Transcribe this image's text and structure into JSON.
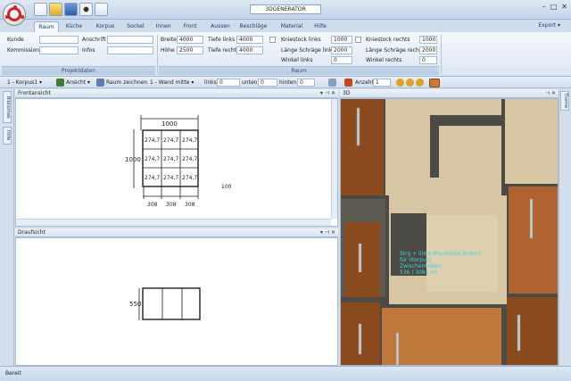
{
  "window": {
    "title": "3DGENERATOR",
    "controls": [
      "–",
      "□",
      "✕"
    ]
  },
  "tabs": [
    "Raum",
    "Küche",
    "Korpus",
    "Sockel",
    "Innen",
    "Front",
    "Aussen",
    "Beschläge",
    "Material",
    "Hilfe"
  ],
  "export_label": "Export ▾",
  "ribbon": {
    "projekt": {
      "footer": "Projektdaten",
      "kunde_label": "Kunde",
      "kommission_label": "Kommission",
      "anschrift_label": "Anschrift",
      "infos_label": "Infos"
    },
    "raum": {
      "footer": "Raum",
      "breite_label": "Breite",
      "breite_value": "4000",
      "hoehe_label": "Höhe",
      "hoehe_value": "2500",
      "tiefe_links_label": "Tiefe links",
      "tiefe_links_value": "4000",
      "tiefe_rechts_label": "Tiefe rechts",
      "tiefe_rechts_value": "4000",
      "kniestock_links_label": "Kniestock links",
      "kniestock_links_value": "1000",
      "laenge_links_label": "Länge Schräge links",
      "laenge_links_value": "2000",
      "winkel_links_label": "Winkel links",
      "winkel_links_value": "0",
      "kniestock_rechts_label": "Kniestock rechts",
      "kniestock_rechts_value": "1000",
      "laenge_rechts_label": "Länge Schräge rechts",
      "laenge_rechts_value": "2000",
      "winkel_rechts_label": "Winkel rechts",
      "winkel_rechts_value": "0"
    }
  },
  "toolbar": {
    "korpus": "1 - Korpus1 ▾",
    "ansicht": "Ansicht ▾",
    "raum_zeichnen": "Raum zeichnen",
    "wand": "1 - Wand mitte ▾",
    "links_label": "links",
    "links_value": "0",
    "unten_label": "unten",
    "unten_value": "0",
    "hinten_label": "hinten",
    "hinten_value": "0",
    "anzahl_label": "Anzahl",
    "anzahl_value": "1"
  },
  "side_tabs": [
    "Bibliothek",
    "Hilfe"
  ],
  "right_tab": "Theme",
  "panels": {
    "front_title": "Frontansicht",
    "top_title": "Draufsicht",
    "view3d_title": "3D"
  },
  "front_drawing": {
    "width_dim": "1000",
    "height_dim": "1000",
    "cell_label": "274,7",
    "bottom_dims": [
      "308",
      "308",
      "308"
    ],
    "cursor_value": "100"
  },
  "top_drawing": {
    "depth_dim": "550"
  },
  "tooltip_3d": {
    "lines": [
      "Strg + linke Maustaste ändern",
      "für (Korpus)",
      "Zwischenboden",
      "536 | 308 | 44"
    ]
  },
  "colors": {
    "wood_dark": "#8a4a1e",
    "wood_light": "#c0773a",
    "panel_beige": "#d6c6a3",
    "shadow": "#4c4a44",
    "tooltip": "#3fd6e0"
  },
  "status": "Bereit"
}
